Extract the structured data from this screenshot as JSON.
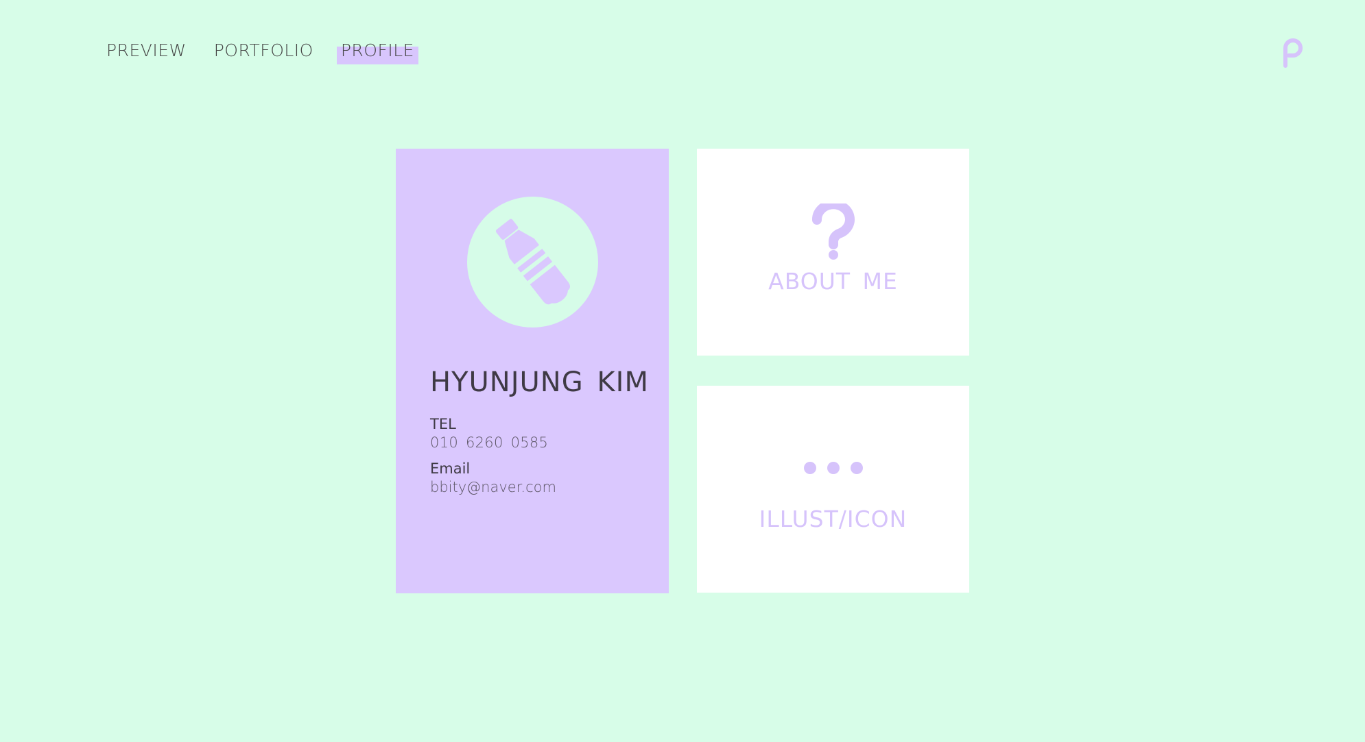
{
  "nav": {
    "items": [
      {
        "label": "PREVIEW"
      },
      {
        "label": "PORTFOLIO"
      },
      {
        "label": "PROFILE",
        "active": true
      }
    ]
  },
  "logo": {
    "icon": "p-logo-icon"
  },
  "profile": {
    "avatar_icon": "water-bottle-icon",
    "name": "HYUNJUNG KIM",
    "tel_label": "TEL",
    "tel_value": "010 6260 0585",
    "email_label": "Email",
    "email_value": "bbity@naver.com"
  },
  "tiles": {
    "about": {
      "icon": "question-mark-icon",
      "label": "ABOUT ME"
    },
    "illust": {
      "icon": "ellipsis-icon",
      "label": "ILLUST/ICON"
    }
  },
  "colors": {
    "background": "#d7fde8",
    "accent_purple": "#dac8fe",
    "label_purple": "#d6c3fb",
    "text_dark": "#3f3a45",
    "tile_white": "#ffffff"
  }
}
